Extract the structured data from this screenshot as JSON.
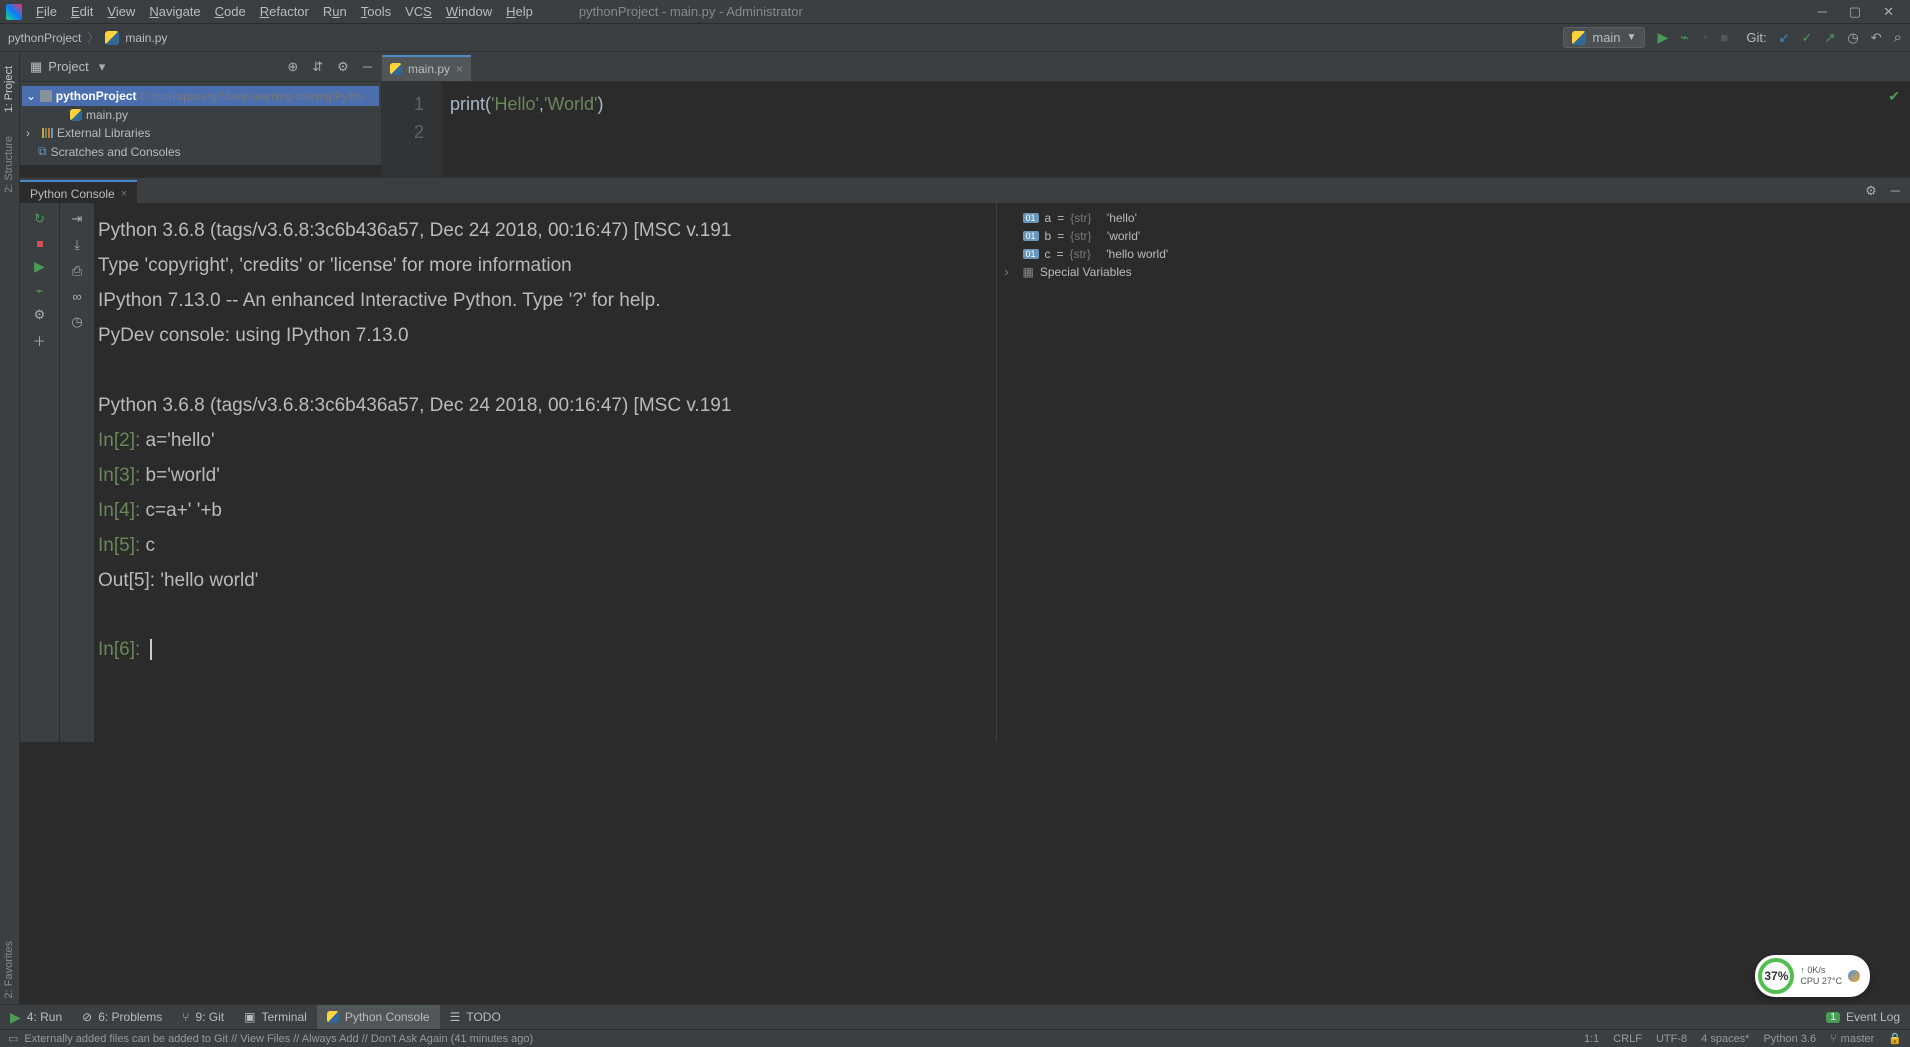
{
  "menu": {
    "file": "File",
    "edit": "Edit",
    "view": "View",
    "navigate": "Navigate",
    "code": "Code",
    "refactor": "Refactor",
    "run": "Run",
    "tools": "Tools",
    "vcs": "VCS",
    "window": "Window",
    "help": "Help"
  },
  "window_title": "pythonProject - main.py - Administrator",
  "breadcrumb": {
    "project": "pythonProject",
    "file": "main.py"
  },
  "runconfig": {
    "name": "main"
  },
  "toolbar": {
    "git_label": "Git:"
  },
  "projectpane": {
    "label": "Project"
  },
  "tree": {
    "project_name": "pythonProject",
    "project_path": "D:\\workspace\\git\\deep-learning-training\\Python基础\\pytho",
    "main_file": "main.py",
    "external": "External Libraries",
    "scratches": "Scratches and Consoles"
  },
  "leftgutter": {
    "project": "1: Project",
    "structure": "2: Structure",
    "favorites": "2: Favorites"
  },
  "tab": {
    "filename": "main.py"
  },
  "code": {
    "line1_num": "1",
    "line2_num": "2",
    "line1": "print('Hello','World')"
  },
  "console": {
    "tab_label": "Python Console",
    "output": [
      "Python 3.6.8 (tags/v3.6.8:3c6b436a57, Dec 24 2018, 00:16:47) [MSC v.191",
      "Type 'copyright', 'credits' or 'license' for more information",
      "IPython 7.13.0 -- An enhanced Interactive Python. Type '?' for help.",
      "PyDev console: using IPython 7.13.0",
      "",
      "Python 3.6.8 (tags/v3.6.8:3c6b436a57, Dec 24 2018, 00:16:47) [MSC v.191"
    ],
    "entries": [
      {
        "prompt": "In[2]: ",
        "code": "a='hello'"
      },
      {
        "prompt": "In[3]: ",
        "code": "b='world'"
      },
      {
        "prompt": "In[4]: ",
        "code": "c=a+' '+b"
      },
      {
        "prompt": "In[5]: ",
        "code": "c"
      }
    ],
    "out": {
      "label": "Out[5]: ",
      "value": "'hello world'"
    },
    "current_prompt": "In[6]: "
  },
  "vars": {
    "a": {
      "name": "a",
      "type": "{str}",
      "value": "'hello'"
    },
    "b": {
      "name": "b",
      "type": "{str}",
      "value": "'world'"
    },
    "c": {
      "name": "c",
      "type": "{str}",
      "value": "'hello world'"
    },
    "special": "Special Variables"
  },
  "bottom": {
    "run": "4: Run",
    "problems": "6: Problems",
    "git": "9: Git",
    "terminal": "Terminal",
    "console": "Python Console",
    "todo": "TODO",
    "eventlog": "Event Log",
    "eventcount": "1"
  },
  "status": {
    "msg": "Externally added files can be added to Git // View Files // Always Add // Don't Ask Again (41 minutes ago)",
    "pos": "1:1",
    "crlf": "CRLF",
    "enc": "UTF-8",
    "indent": "4 spaces*",
    "interp": "Python 3.6",
    "branch": "master"
  },
  "perf": {
    "pct": "37%",
    "net": "0K/s",
    "cpu": "CPU 27°C"
  }
}
